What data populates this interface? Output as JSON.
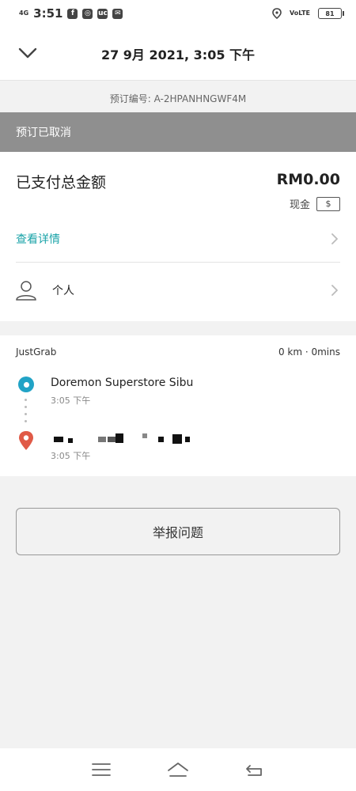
{
  "status_bar": {
    "time": "3:51",
    "network": "4G",
    "volte": "VoLTE",
    "battery": "81",
    "app_icons": [
      "facebook-icon",
      "instagram-icon",
      "uc-icon",
      "mail-icon"
    ]
  },
  "header": {
    "title": "27 9月 2021, 3:05 下午"
  },
  "booking": {
    "code_label": "预订编号: A-2HPANHNGWF4M"
  },
  "banner": {
    "status": "预订已取消"
  },
  "payment": {
    "total_label": "已支付总金额",
    "total_amount": "RM0.00",
    "method_label": "现金",
    "method_icon": "$"
  },
  "rows": {
    "details_link": "查看详情",
    "personal_label": "个人"
  },
  "trip": {
    "service": "JustGrab",
    "summary": "0 km · 0mins",
    "pickup_name": "Doremon Superstore Sibu",
    "pickup_time": "3:05 下午",
    "dropoff_time": "3:05 下午"
  },
  "actions": {
    "report_label": "举报问题"
  },
  "colors": {
    "accent_teal": "#1aa3a8",
    "pickup_blue": "#21a3c6",
    "dropoff_red": "#e05a47",
    "banner_gray": "#8f8f8f"
  }
}
